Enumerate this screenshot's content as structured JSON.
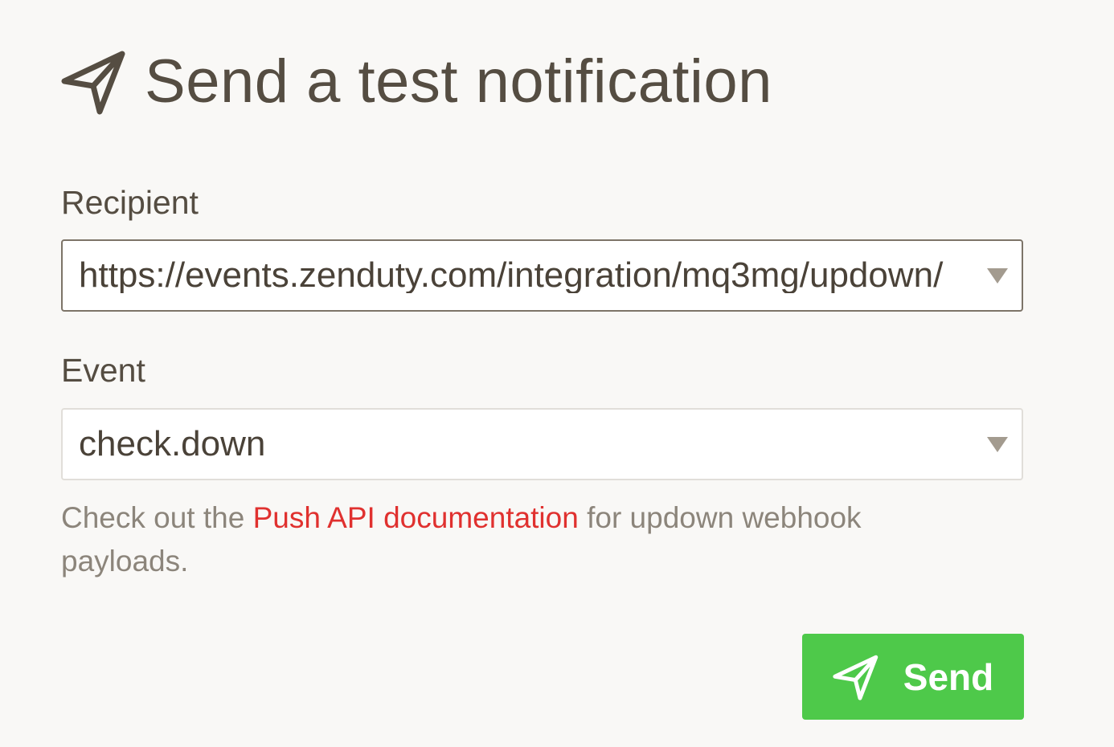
{
  "dialog": {
    "title": "Send a test notification",
    "title_icon": "paper-plane-icon"
  },
  "recipient": {
    "label": "Recipient",
    "value": "https://events.zenduty.com/integration/mq3mg/updown/",
    "arrow_icon": "triangle-down-icon"
  },
  "event": {
    "label": "Event",
    "value": "check.down",
    "arrow_icon": "triangle-down-icon"
  },
  "help": {
    "prefix": "Check out the ",
    "link_text": "Push API documentation",
    "suffix": " for updown webhook payloads."
  },
  "send_button": {
    "label": "Send",
    "icon": "paper-plane-icon"
  },
  "colors": {
    "background": "#f9f8f6",
    "text": "#554d42",
    "link": "#e0312f",
    "button": "#4ec94a",
    "button_text": "#ffffff"
  }
}
